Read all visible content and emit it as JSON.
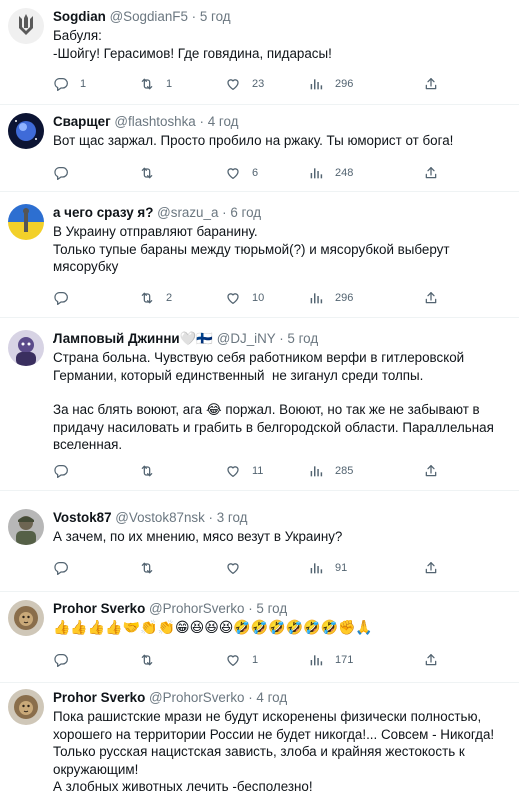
{
  "tweets": [
    {
      "display_name": "Sogdian",
      "handle": "@SogdianF5",
      "separator": "·",
      "time": "5 год",
      "lines": [
        "Бабуля:",
        "-Шойгу! Герасимов! Где говядина, пидарасы!"
      ],
      "replies": "1",
      "retweets": "1",
      "likes": "23",
      "views": "296",
      "avatar": "trident-emblem-avatar"
    },
    {
      "display_name": "Сварщег",
      "handle": "@flashtoshka",
      "separator": "·",
      "time": "4 год",
      "lines": [
        "Вот щас заржал. Просто пробило на ржаку. Ты юморист от бога!"
      ],
      "replies": "",
      "retweets": "",
      "likes": "6",
      "views": "248",
      "avatar": "planet-avatar"
    },
    {
      "display_name": "а чего сразу я?",
      "handle": "@srazu_a",
      "separator": "·",
      "time": "6 год",
      "lines": [
        "В Украину отправляют баранину.",
        "Только тупые бараны между тюрьмой(?) и мясорубкой выберут",
        "мясорубку"
      ],
      "replies": "",
      "retweets": "2",
      "likes": "10",
      "views": "296",
      "avatar": "flag-statue-avatar"
    },
    {
      "display_name": "Ламповый Джинни🤍🇫🇮",
      "handle": "@DJ_iNY",
      "separator": "·",
      "time": "5 год",
      "lines": [
        "Страна больна. Чувствую себя работником верфи в гитлеровской",
        "Германии, который единственный  не зиганул среди толпы.",
        "",
        "За нас блять воюют, ага 😂 поржал. Воюют, но так же не забывают в",
        "придачу насиловать и грабить в белгородской области. Параллельная",
        "вселенная."
      ],
      "replies": "",
      "retweets": "",
      "likes": "11",
      "views": "285",
      "avatar": "cartoon-avatar"
    },
    {
      "display_name": "Vostok87",
      "handle": "@Vostok87nsk",
      "separator": "·",
      "time": "3 год",
      "lines": [
        "А зачем, по их мнению, мясо везут в Украину?"
      ],
      "replies": "",
      "retweets": "",
      "likes": "",
      "views": "91",
      "avatar": "soldier-avatar"
    },
    {
      "display_name": "Prohor Sverko",
      "handle": "@ProhorSverko",
      "separator": "·",
      "time": "5 год",
      "lines": [
        "👍👍👍👍🤝👏👏😁😆😆😆🤣🤣🤣🤣🤣🤣✊🙏"
      ],
      "replies": "",
      "retweets": "",
      "likes": "1",
      "views": "171",
      "avatar": "lion-avatar"
    },
    {
      "display_name": "Prohor Sverko",
      "handle": "@ProhorSverko",
      "separator": "·",
      "time": "4 год",
      "lines": [
        "Пока рашистские мрази не будут искоренены физически полностью,",
        "хорошего на территории России не будет никогда!... Совсем - Никогда!",
        "Только русская нацистская зависть, злоба и крайняя жестокость к",
        "окружающим!",
        "А злобных животных лечить -бесполезно!"
      ],
      "replies": "",
      "retweets": "",
      "likes": "",
      "views": "",
      "avatar": "lion-avatar"
    }
  ],
  "colors": {
    "text": "#0f1419",
    "secondary": "#536471",
    "divider": "#eff3f4"
  }
}
